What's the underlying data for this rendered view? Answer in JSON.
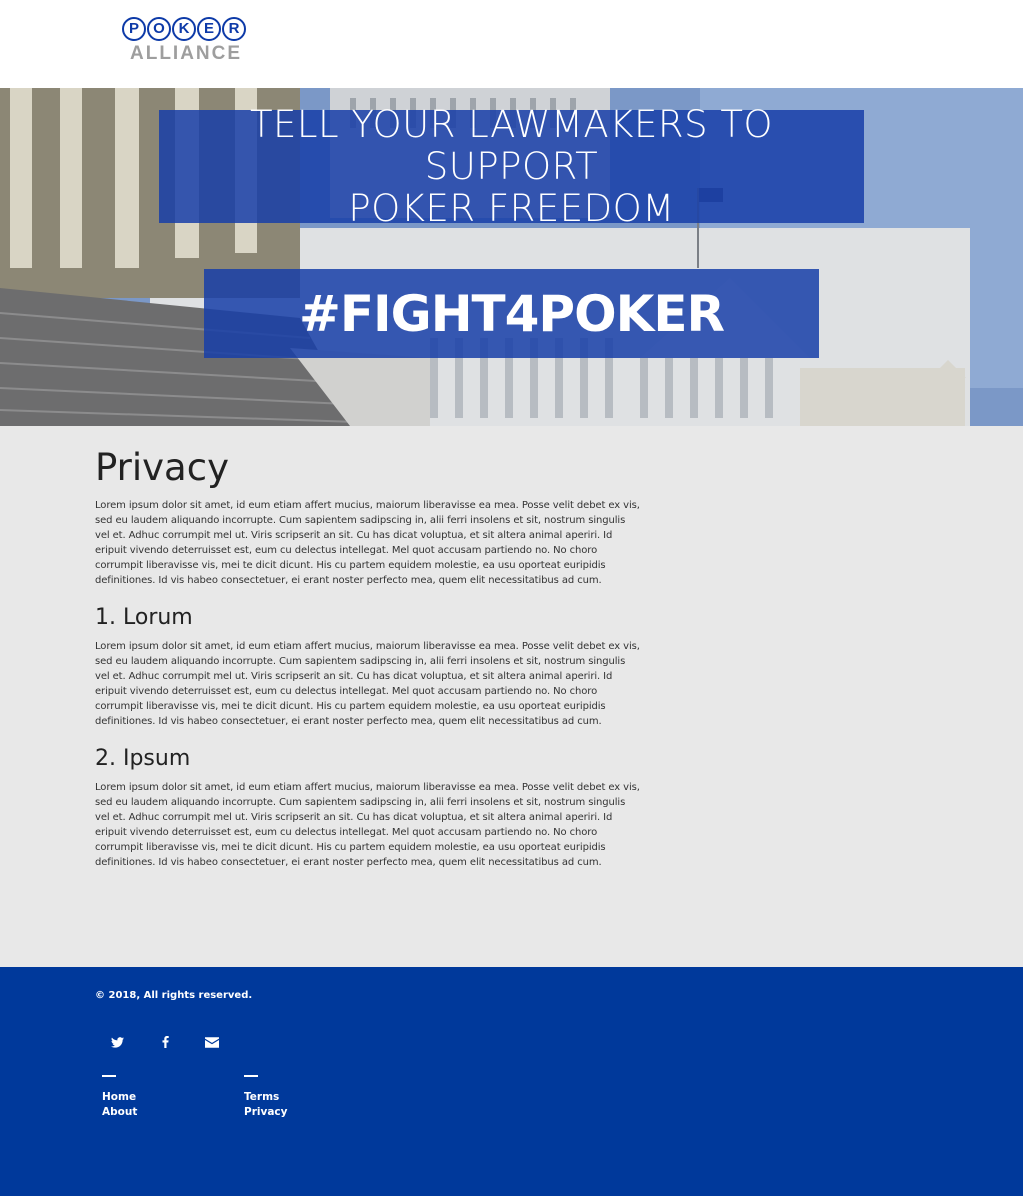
{
  "header": {
    "logo": {
      "letters": [
        "P",
        "O",
        "K",
        "E",
        "R"
      ],
      "sub": "ALLIANCE"
    }
  },
  "hero": {
    "headline_lines": [
      "TELL YOUR LAWMAKERS TO SUPPORT",
      "POKER FREEDOM"
    ],
    "hashtag": "#FIGHT4POKER"
  },
  "main": {
    "title": "Privacy",
    "intro": "Lorem ipsum dolor sit amet, id eum etiam affert mucius, maiorum liberavisse ea mea. Posse velit debet ex vis, sed eu laudem aliquando incorrupte. Cum sapientem sadipscing in, alii ferri insolens et sit, nostrum singulis vel et. Adhuc corrumpit mel ut. Viris scripserit an sit. Cu has dicat voluptua, et sit altera animal aperiri. Id eripuit vivendo deterruisset est, eum cu delectus intellegat. Mel quot accusam partiendo no. No choro corrumpit liberavisse vis, mei te dicit dicunt. His cu partem equidem molestie, ea usu oporteat euripidis definitiones. Id vis habeo consectetuer, ei erant noster perfecto mea, quem elit necessitatibus ad cum.",
    "sections": [
      {
        "title": "1. Lorum",
        "body": "Lorem ipsum dolor sit amet, id eum etiam affert mucius, maiorum liberavisse ea mea. Posse velit debet ex vis, sed eu laudem aliquando incorrupte. Cum sapientem sadipscing in, alii ferri insolens et sit, nostrum singulis vel et. Adhuc corrumpit mel ut. Viris scripserit an sit. Cu has dicat voluptua, et sit altera animal aperiri. Id eripuit vivendo deterruisset est, eum cu delectus intellegat. Mel quot accusam partiendo no. No choro corrumpit liberavisse vis, mei te dicit dicunt. His cu partem equidem molestie, ea usu oporteat euripidis definitiones. Id vis habeo consectetuer, ei erant noster perfecto mea, quem elit necessitatibus ad cum."
      },
      {
        "title": "2. Ipsum",
        "body": "Lorem ipsum dolor sit amet, id eum etiam affert mucius, maiorum liberavisse ea mea. Posse velit debet ex vis, sed eu laudem aliquando incorrupte. Cum sapientem sadipscing in, alii ferri insolens et sit, nostrum singulis vel et. Adhuc corrumpit mel ut. Viris scripserit an sit. Cu has dicat voluptua, et sit altera animal aperiri. Id eripuit vivendo deterruisset est, eum cu delectus intellegat. Mel quot accusam partiendo no. No choro corrumpit liberavisse vis, mei te dicit dicunt. His cu partem equidem molestie, ea usu oporteat euripidis definitiones. Id vis habeo consectetuer, ei erant noster perfecto mea, quem elit necessitatibus ad cum."
      }
    ]
  },
  "footer": {
    "copyright": "© 2018, All rights reserved.",
    "social_icons": [
      "twitter-icon",
      "facebook-icon",
      "email-icon"
    ],
    "links_col1": [
      "Home",
      "About"
    ],
    "links_col2": [
      "Terms",
      "Privacy"
    ]
  },
  "colors": {
    "brand_blue": "#0d3aa8",
    "footer_blue": "#00399b",
    "hero_box": "#173ea8",
    "content_bg": "#e8e8e8",
    "logo_grey": "#9e9e9e"
  }
}
